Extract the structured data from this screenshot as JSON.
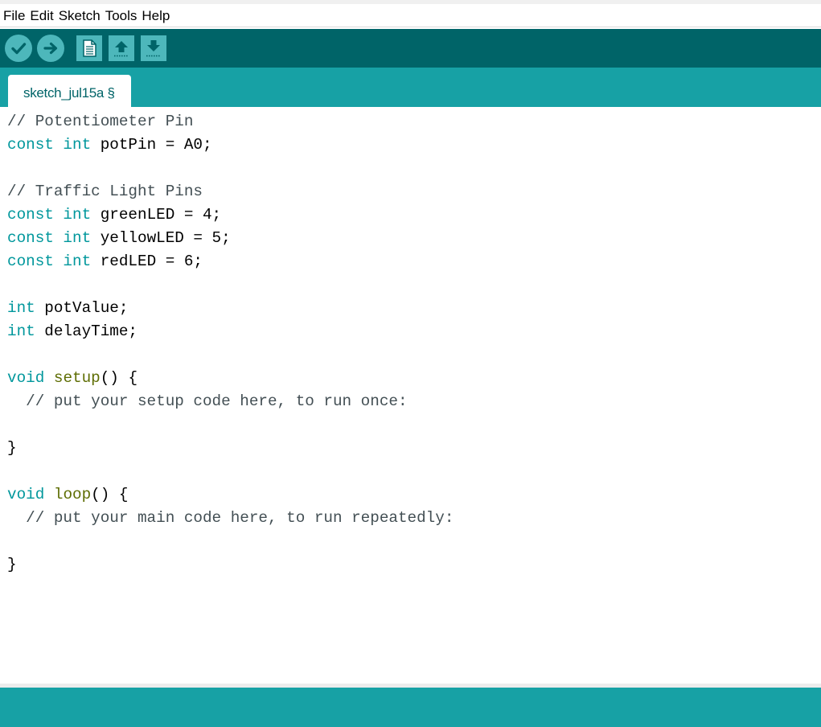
{
  "menu": [
    "File",
    "Edit",
    "Sketch",
    "Tools",
    "Help"
  ],
  "toolbar": {
    "buttons": [
      {
        "name": "verify-button",
        "icon": "check-icon"
      },
      {
        "name": "upload-button",
        "icon": "arrow-right-icon"
      },
      {
        "name": "new-button",
        "icon": "document-icon"
      },
      {
        "name": "open-button",
        "icon": "arrow-up-icon"
      },
      {
        "name": "save-button",
        "icon": "arrow-down-icon"
      }
    ]
  },
  "tab": {
    "label": "sketch_jul15a §"
  },
  "code": {
    "l1": "// Potentiometer Pin",
    "l2_kw": "const int",
    "l2_rest": " potPin = A0;",
    "l4": "// Traffic Light Pins",
    "l5_kw": "const int",
    "l5_rest": " greenLED = 4;",
    "l6_kw": "const int",
    "l6_rest": " yellowLED = 5;",
    "l7_kw": "const int",
    "l7_rest": " redLED = 6;",
    "l9_kw": "int",
    "l9_rest": " potValue;",
    "l10_kw": "int",
    "l10_rest": " delayTime;",
    "l12_kw": "void",
    "l12_fn": "setup",
    "l12_rest": "() {",
    "l13": "  // put your setup code here, to run once:",
    "l15": "}",
    "l17_kw": "void",
    "l17_fn": "loop",
    "l17_rest": "() {",
    "l18": "  // put your main code here, to run repeatedly:",
    "l20": "}"
  },
  "colors": {
    "toolbar": "#006468",
    "tabbar": "#17a1a5",
    "button": "#4db7bb",
    "keyword": "#00979c",
    "function": "#5e6d03",
    "comment": "#434f54"
  }
}
